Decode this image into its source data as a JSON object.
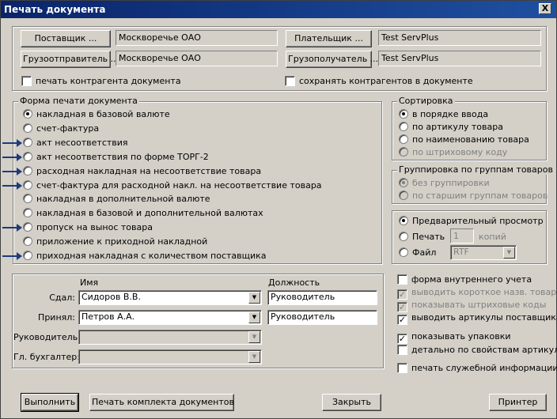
{
  "window": {
    "title": "Печать документа",
    "close_label": "X"
  },
  "parties": {
    "supplier_button": "Поставщик ...",
    "supplier_value": "Москворечье ОАО",
    "shipper_button": "Грузоотправитель ...",
    "shipper_value": "Москворечье ОАО",
    "payer_button": "Плательщик ...",
    "payer_value": "Test ServPlus",
    "consignee_button": "Грузополучатель ...",
    "consignee_value": "Test ServPlus",
    "print_contractor_label": "печать контрагента документа",
    "print_contractor_checked": false,
    "save_contractors_label": "сохранять контрагентов в документе",
    "save_contractors_checked": false
  },
  "form": {
    "legend": "Форма печати документа",
    "items": [
      {
        "label": "накладная в базовой валюте",
        "selected": true,
        "marked": false
      },
      {
        "label": "счет-фактура",
        "selected": false,
        "marked": false
      },
      {
        "label": "акт несоответствия",
        "selected": false,
        "marked": true
      },
      {
        "label": "акт несоответствия по форме ТОРГ-2",
        "selected": false,
        "marked": true
      },
      {
        "label": "расходная накладная на несоответствие товара",
        "selected": false,
        "marked": true
      },
      {
        "label": "счет-фактура для расходной накл. на несоответствие товара",
        "selected": false,
        "marked": true
      },
      {
        "label": "накладная в дополнительной валюте",
        "selected": false,
        "marked": false
      },
      {
        "label": "накладная в базовой и дополнительной валютах",
        "selected": false,
        "marked": false
      },
      {
        "label": "пропуск на вынос товара",
        "selected": false,
        "marked": true
      },
      {
        "label": "приложение к приходной накладной",
        "selected": false,
        "marked": false
      },
      {
        "label": "приходная накладная с количеством поставщика",
        "selected": false,
        "marked": true
      }
    ]
  },
  "sorting": {
    "legend": "Сортировка",
    "items": [
      {
        "label": "в порядке ввода",
        "selected": true,
        "disabled": false
      },
      {
        "label": "по артикулу товара",
        "selected": false,
        "disabled": false
      },
      {
        "label": "по наименованию товара",
        "selected": false,
        "disabled": false
      },
      {
        "label": "по штриховому коду",
        "selected": false,
        "disabled": true
      }
    ]
  },
  "grouping": {
    "legend": "Группировка по группам товаров",
    "items": [
      {
        "label": "без группировки",
        "selected": true,
        "disabled": true
      },
      {
        "label": "по старшим группам товаров",
        "selected": false,
        "disabled": true
      }
    ]
  },
  "output": {
    "preview_label": "Предварительный просмотр",
    "print_label": "Печать",
    "copies_value": "1",
    "copies_label": "копий",
    "file_label": "Файл",
    "file_format": "RTF"
  },
  "signers": {
    "name_header": "Имя",
    "position_header": "Должность",
    "rows": [
      {
        "label": "Сдал:",
        "name": "Сидоров В.В.",
        "position": "Руководитель",
        "enabled": true
      },
      {
        "label": "Принял:",
        "name": "Петров А.А.",
        "position": "Руководитель",
        "enabled": true
      },
      {
        "label": "Руководитель:",
        "name": "",
        "position": "",
        "enabled": false
      },
      {
        "label": "Гл. бухгалтер:",
        "name": "",
        "position": "",
        "enabled": false
      }
    ]
  },
  "options": {
    "items": [
      {
        "label": "форма внутреннего учета",
        "checked": false,
        "disabled": false
      },
      {
        "label": "выводить короткое назв. товара",
        "checked": true,
        "disabled": true
      },
      {
        "label": "показывать штриховые коды",
        "checked": true,
        "disabled": true
      },
      {
        "label": "выводить артикулы поставщика",
        "checked": true,
        "disabled": false
      },
      {
        "label": "показывать упаковки",
        "checked": true,
        "disabled": false
      },
      {
        "label": "детально по свойствам артикулов",
        "checked": false,
        "disabled": false
      },
      {
        "label": "печать служебной информации",
        "checked": false,
        "disabled": false
      }
    ]
  },
  "footer": {
    "execute": "Выполнить",
    "print_set": "Печать комплекта документов",
    "close": "Закрыть",
    "printer": "Принтер"
  },
  "colors": {
    "title_bar": "#0a246a",
    "face": "#d4d0c8",
    "arrow": "#1f3a7a"
  }
}
